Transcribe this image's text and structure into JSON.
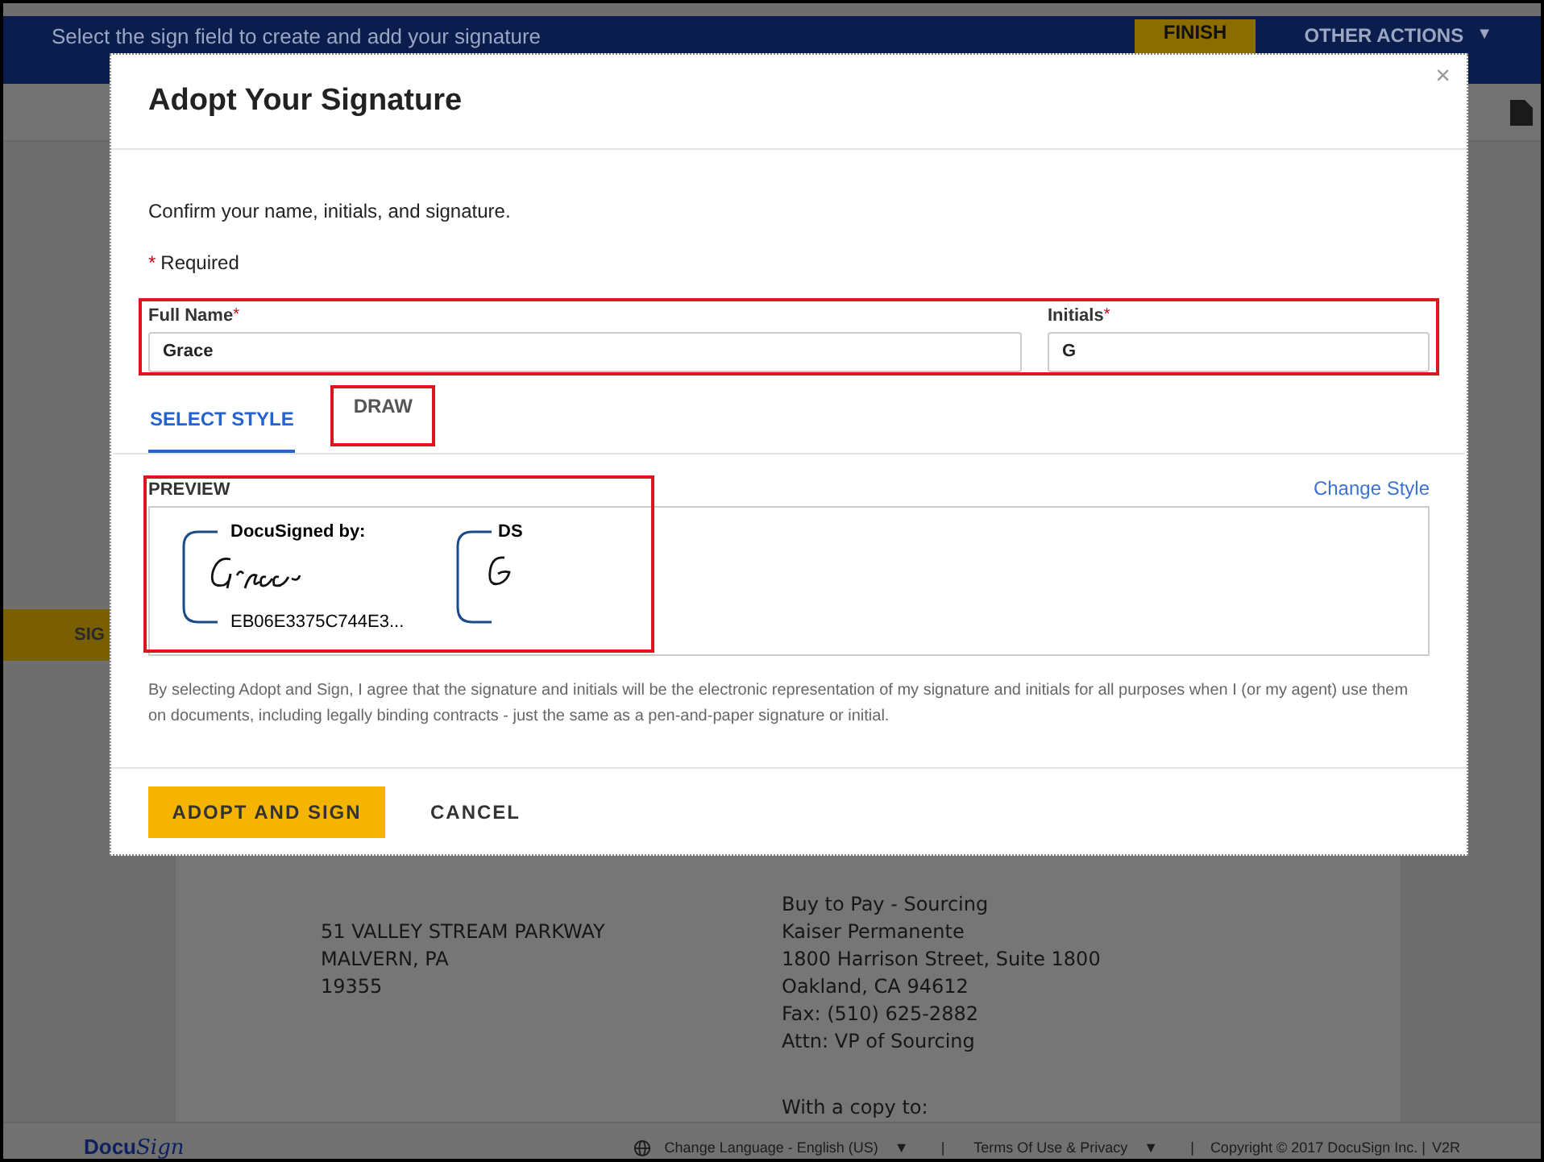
{
  "top_bar": {
    "message": "Select the sign field to create and add your signature",
    "finish": "FINISH",
    "other_actions": "OTHER ACTIONS",
    "caret": "▼"
  },
  "side_tab": {
    "label": "SIG"
  },
  "document": {
    "left_lines": [
      "51 VALLEY STREAM PARKWAY",
      "MALVERN, PA",
      "19355"
    ],
    "right_lines": [
      "Buy to Pay - Sourcing",
      "Kaiser Permanente",
      "1800 Harrison Street, Suite 1800",
      "Oakland, CA 94612",
      "Fax: (510) 625-2882",
      "Attn: VP of Sourcing"
    ],
    "right_footer": "With a copy to:"
  },
  "footer": {
    "logo_a": "Docu",
    "logo_b": "Sign",
    "language": "Change Language - English (US)",
    "separator": "|",
    "caret": "▼",
    "terms": "Terms Of Use & Privacy",
    "copyright": "Copyright © 2017 DocuSign Inc. |",
    "version": "V2R"
  },
  "dialog": {
    "title": "Adopt Your Signature",
    "close": "×",
    "intro": "Confirm your name, initials, and signature.",
    "required_mark": "*",
    "required": "Required",
    "fields": [
      {
        "label": "Full Name",
        "value": "Grace"
      },
      {
        "label": "Initials",
        "value": "G"
      }
    ],
    "tabs": [
      {
        "label": "SELECT STYLE",
        "selected": true,
        "highlighted": false
      },
      {
        "label": "DRAW",
        "selected": false,
        "highlighted": true
      }
    ],
    "preview_label": "PREVIEW",
    "change_style": "Change Style",
    "signature": {
      "caption": "DocuSigned by:",
      "id": "EB06E3375C744E3..."
    },
    "initials": {
      "caption": "DS"
    },
    "legal": "By selecting Adopt and Sign, I agree that the signature and initials will be the electronic representation of my signature and initials for all purposes when I (or my agent) use them on documents, including legally binding contracts - just the same as a pen-and-paper signature or initial.",
    "buttons": [
      {
        "kind": "primary",
        "label": "ADOPT AND SIGN"
      },
      {
        "kind": "plain",
        "label": "CANCEL"
      }
    ]
  }
}
